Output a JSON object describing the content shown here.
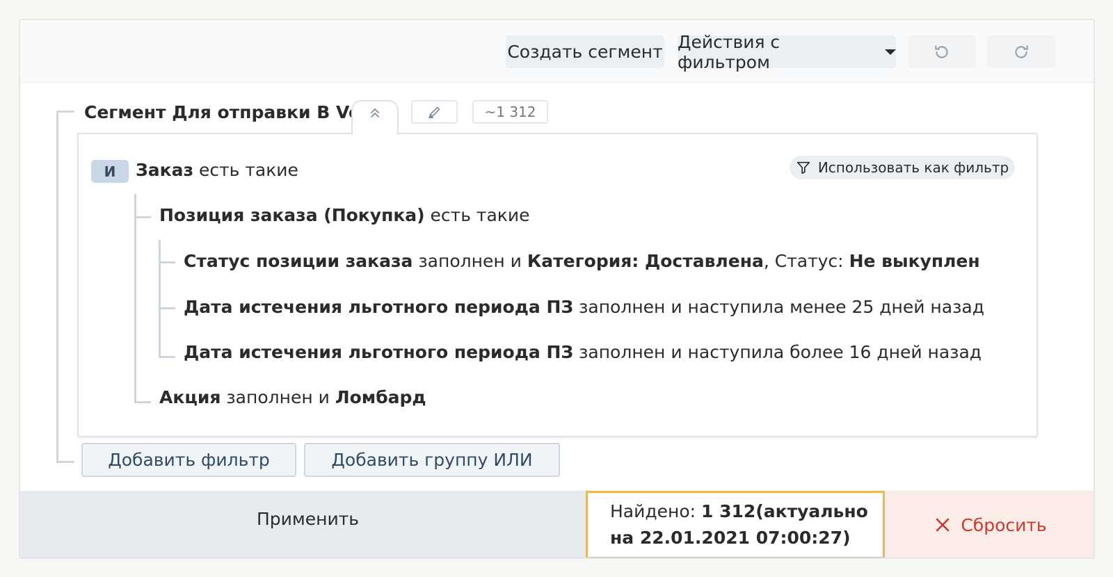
{
  "toolbar": {
    "create_segment": "Создать сегмент",
    "filter_actions": "Действия с фильтром"
  },
  "segment": {
    "title": "Сегмент Для отправки В Vox",
    "count": "~1 312"
  },
  "group": {
    "operator": "И",
    "use_as_filter": "Использовать как фильтр",
    "order": {
      "name": "Заказ",
      "suffix": " есть такие"
    },
    "position": {
      "name": "Позиция заказа (Покупка)",
      "suffix": " есть такие"
    },
    "conditions": [
      {
        "field": "Статус позиции заказа",
        "op": " заполнен и ",
        "cat_label": "Категория:  Доставлена",
        "status_label": ", Статус:  ",
        "status_value": "Не выкуплен"
      },
      {
        "field": "Дата истечения льготного периода ПЗ",
        "op": " заполнен и наступила менее 25 дней назад"
      },
      {
        "field": "Дата истечения льготного периода ПЗ",
        "op": " заполнен и наступила более 16 дней назад"
      }
    ],
    "promo": {
      "field": "Акция",
      "op": " заполнен и ",
      "value": "Ломбард"
    }
  },
  "add_filter": "Добавить фильтр",
  "add_or_group": "Добавить группу ИЛИ",
  "bottom": {
    "apply": "Применить",
    "found_label": "Найдено: ",
    "found_value": "1 312(актуально",
    "found_date": "на 22.01.2021 07:00:27)",
    "reset": "Сбросить"
  },
  "colors": {
    "accent_border": "#e8b85a",
    "reset_text": "#c9392d",
    "badge_bg": "#c9d7e6"
  }
}
